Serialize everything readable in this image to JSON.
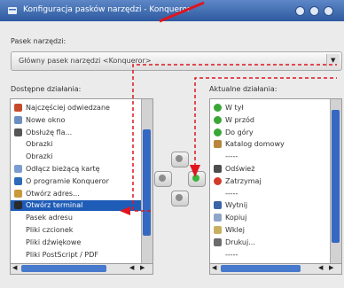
{
  "window": {
    "title": "Konfiguracja pasków narzędzi - Konqueror"
  },
  "toolbar_label": "Pasek narzędzi:",
  "toolbar_combo": {
    "selected": "Główny pasek narzędzi <Konqueror>"
  },
  "available": {
    "label": "Dostępne działania:",
    "items": [
      {
        "label": "Najczęściej odwiedzane",
        "icon": "star-icon",
        "color": "#c64b2a"
      },
      {
        "label": "Nowe okno",
        "icon": "window-icon",
        "color": "#6a8fc4"
      },
      {
        "label": "Obsłużę fla...",
        "icon": "document-icon",
        "color": "#555555"
      },
      {
        "label": "Obrazki",
        "icon": "",
        "color": ""
      },
      {
        "label": "Obrazki",
        "icon": "",
        "color": ""
      },
      {
        "label": "Odłącz bieżącą kartę",
        "icon": "tab-icon",
        "color": "#7a9cd0"
      },
      {
        "label": "O programie Konqueror",
        "icon": "konqueror-icon",
        "color": "#2d6ab8"
      },
      {
        "label": "Otwórz adres...",
        "icon": "open-address-icon",
        "color": "#c99a3a"
      },
      {
        "label": "Otwórz terminal",
        "icon": "terminal-icon",
        "color": "#2a2a2a"
      },
      {
        "label": "Pasek adresu",
        "icon": "",
        "color": ""
      },
      {
        "label": "Pliki czcionek",
        "icon": "",
        "color": ""
      },
      {
        "label": "Pliki dźwiękowe",
        "icon": "",
        "color": ""
      },
      {
        "label": "Pliki PostScript / PDF",
        "icon": "",
        "color": ""
      }
    ],
    "selected_index": 8
  },
  "current": {
    "label": "Aktualne działania:",
    "items": [
      {
        "label": "W tył",
        "icon": "back-icon",
        "color": "#3aa637"
      },
      {
        "label": "W przód",
        "icon": "forward-icon",
        "color": "#3aa637"
      },
      {
        "label": "Do góry",
        "icon": "up-icon",
        "color": "#3aa637"
      },
      {
        "label": "Katalog domowy",
        "icon": "home-icon",
        "color": "#b9853c"
      },
      {
        "label": "-----",
        "icon": "",
        "color": ""
      },
      {
        "label": "Odśwież",
        "icon": "reload-icon",
        "color": "#4d4d4d"
      },
      {
        "label": "Zatrzymaj",
        "icon": "stop-icon",
        "color": "#d23a2a"
      },
      {
        "label": "-----",
        "icon": "",
        "color": ""
      },
      {
        "label": "Wytnij",
        "icon": "cut-icon",
        "color": "#3a64a8"
      },
      {
        "label": "Kopiuj",
        "icon": "copy-icon",
        "color": "#8fa6c8"
      },
      {
        "label": "Wklej",
        "icon": "paste-icon",
        "color": "#c9b060"
      },
      {
        "label": "Drukuj...",
        "icon": "print-icon",
        "color": "#6b6b6b"
      },
      {
        "label": "-----",
        "icon": "",
        "color": ""
      }
    ]
  },
  "arrow_buttons": {
    "up": "up-arrow-icon",
    "left": "left-arrow-icon",
    "right": "right-arrow-icon",
    "down": "down-arrow-icon"
  },
  "colors": {
    "selection": "#1f5cb8",
    "annotation": "#e0151e",
    "titlebar": "#2e5aa0"
  }
}
